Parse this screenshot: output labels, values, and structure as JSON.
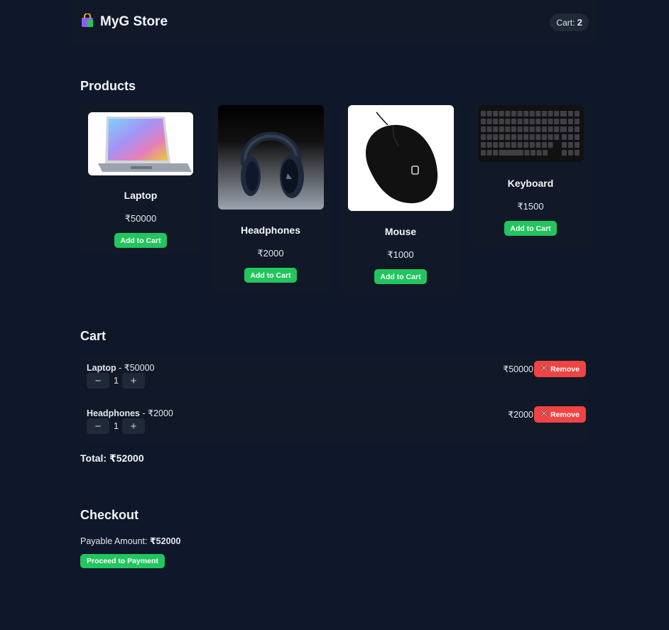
{
  "header": {
    "title": "MyG Store",
    "cart_label": "Cart:",
    "cart_count": "2"
  },
  "products": {
    "heading": "Products",
    "items": [
      {
        "name": "Laptop",
        "price": "₹50000",
        "button": "Add to Cart"
      },
      {
        "name": "Headphones",
        "price": "₹2000",
        "button": "Add to Cart"
      },
      {
        "name": "Mouse",
        "price": "₹1000",
        "button": "Add to Cart"
      },
      {
        "name": "Keyboard",
        "price": "₹1500",
        "button": "Add to Cart"
      }
    ]
  },
  "cart": {
    "heading": "Cart",
    "items": [
      {
        "name": "Laptop",
        "unit_price": " - ₹50000",
        "qty": "1",
        "line_total": "₹50000",
        "remove": "Remove"
      },
      {
        "name": "Headphones",
        "unit_price": " - ₹2000",
        "qty": "1",
        "line_total": "₹2000",
        "remove": "Remove"
      }
    ],
    "total": "Total: ₹52000"
  },
  "checkout": {
    "heading": "Checkout",
    "payable_label": "Payable Amount: ",
    "payable_value": "₹52000",
    "proceed_button": "Proceed to Payment"
  },
  "colors": {
    "background": "#0f172a",
    "panel": "#111827",
    "accent_green": "#22c55e",
    "danger_red": "#ef4444"
  },
  "icons": {
    "brand": "shopping-bag-icon",
    "minus": "minus-icon",
    "plus": "plus-icon",
    "remove": "cross-mark-icon"
  }
}
